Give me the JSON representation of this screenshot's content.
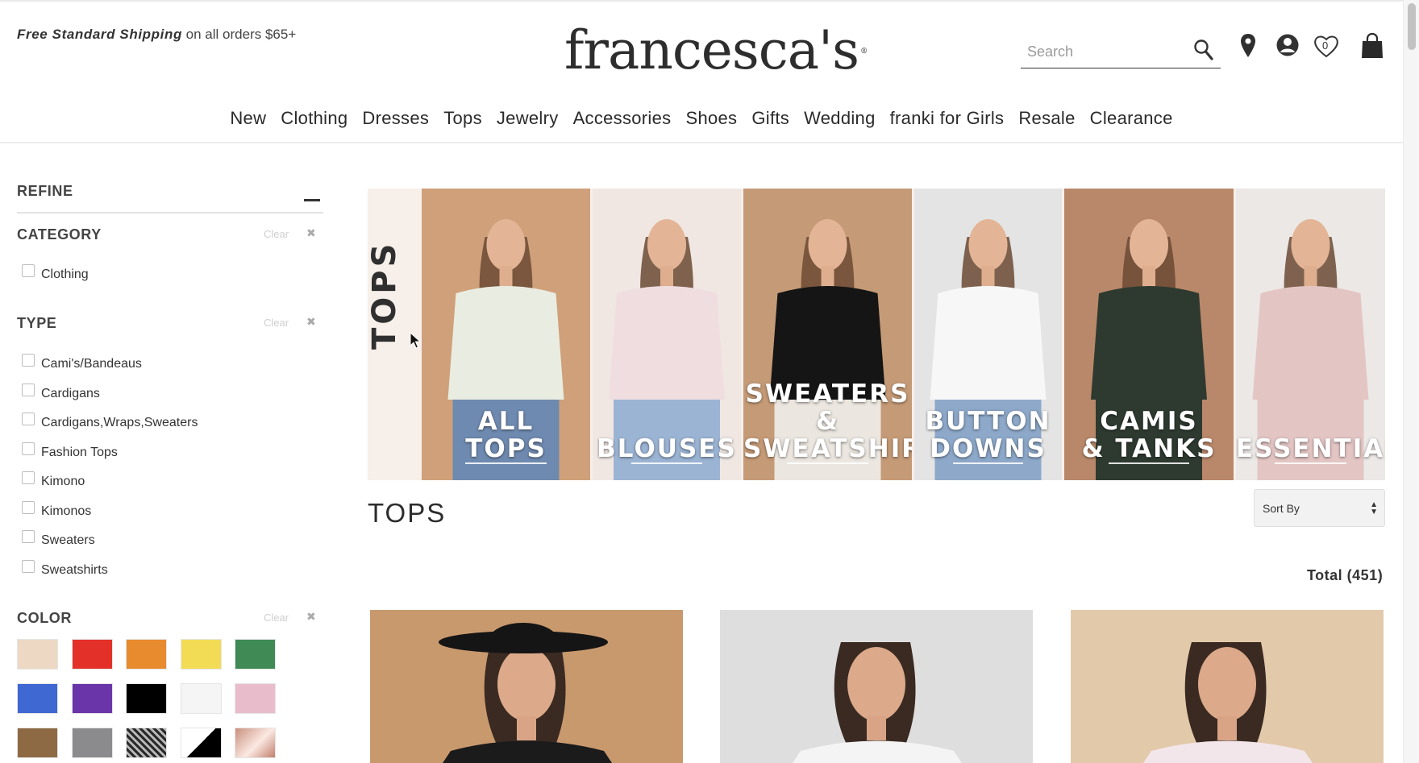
{
  "header": {
    "promo_bold": "Free Standard Shipping",
    "promo_rest": " on all orders $65+",
    "logo": "francesca's",
    "logo_mark": "®",
    "search_placeholder": "Search",
    "wishlist_count": "0"
  },
  "nav": [
    "New",
    "Clothing",
    "Dresses",
    "Tops",
    "Jewelry",
    "Accessories",
    "Shoes",
    "Gifts",
    "Wedding",
    "franki for Girls",
    "Resale",
    "Clearance"
  ],
  "sidebar": {
    "refine_label": "REFINE",
    "clear_label": "Clear",
    "category": {
      "title": "CATEGORY",
      "options": [
        "Clothing"
      ]
    },
    "type": {
      "title": "TYPE",
      "options": [
        "Cami's/Bandeaus",
        "Cardigans",
        "Cardigans,Wraps,Sweaters",
        "Fashion Tops",
        "Kimono",
        "Kimonos",
        "Sweaters",
        "Sweatshirts"
      ]
    },
    "color": {
      "title": "COLOR",
      "swatches": [
        "#ecd8c3",
        "#e3312a",
        "#e88a2e",
        "#f3dc55",
        "#3f8a55",
        "#3f68d3",
        "#6a35a8",
        "#000000",
        "#f5f5f5",
        "#e9bccb",
        "#8d6a43",
        "#8b8b8d",
        "pattern",
        "black-white",
        "rose-gold"
      ]
    }
  },
  "banner": {
    "vertical_title": "TOPS",
    "tiles": [
      {
        "label": "ALL\nTOPS",
        "bg": "#cfa07a",
        "shirt": "#e9ece1",
        "jeans": "#6f8ab0"
      },
      {
        "label": "BLOUSES",
        "bg": "#f0e7e3",
        "shirt": "#efdde0",
        "jeans": "#9bb4d4"
      },
      {
        "label": "SWEATERS &\nSWEATSHIRT",
        "bg": "#c59a76",
        "shirt": "#151515",
        "jeans": "#ebe6df"
      },
      {
        "label": "BUTTON\nDOWNS",
        "bg": "#e4e4e4",
        "shirt": "#f7f7f7",
        "jeans": "#8da8c9"
      },
      {
        "label": "CAMIS\n& TANKS",
        "bg": "#b9886a",
        "shirt": "#2e3a30",
        "jeans": "#2e3a30"
      },
      {
        "label": "ESSENTIALS",
        "bg": "#ece8e6",
        "shirt": "#e3c6c4",
        "jeans": "#e3c6c4"
      }
    ]
  },
  "main": {
    "section_title": "TOPS",
    "sort_label": "Sort By",
    "total_label": "Total (451)"
  },
  "products": [
    {
      "bg": "#c9996e",
      "top": "#1b1b1b",
      "hat": true
    },
    {
      "bg": "#dedede",
      "top": "#f4f4f4",
      "hat": false
    },
    {
      "bg": "#e2c9aa",
      "top": "#f3e6ea",
      "hat": false
    }
  ],
  "colors": {
    "text_dark": "#2d2d2d",
    "rule": "#e3e3e3"
  }
}
